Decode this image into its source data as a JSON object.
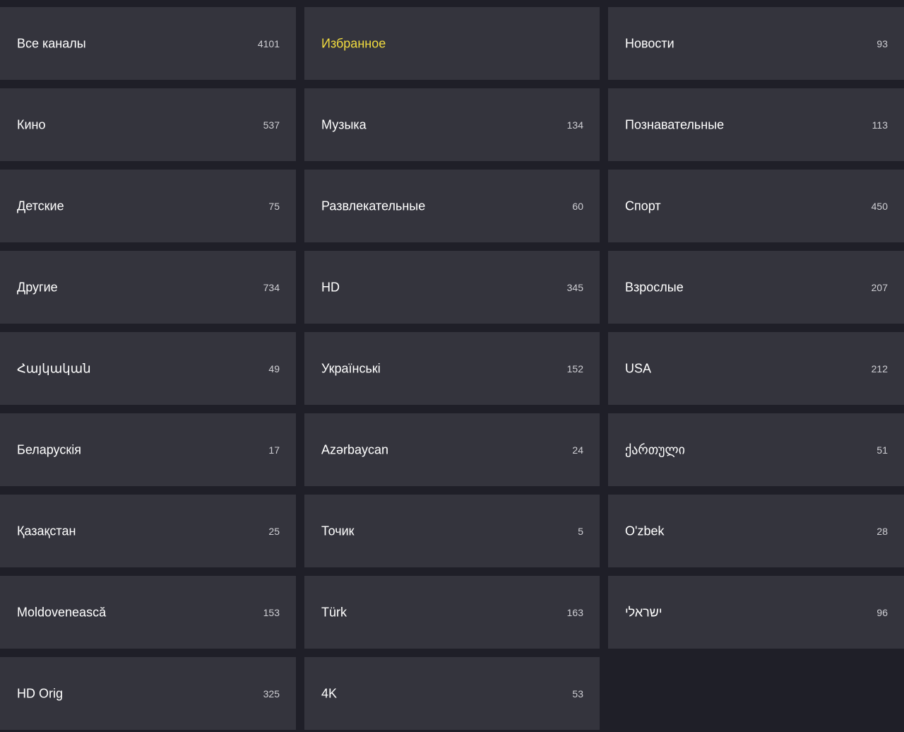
{
  "colors": {
    "background": "#1f1f28",
    "tile": "#34343d",
    "label": "#ffffff",
    "count": "#cfcfd4",
    "highlight": "#f2dc3f"
  },
  "categories": [
    {
      "label": "Все каналы",
      "count": "4101"
    },
    {
      "label": "Избранное",
      "count": "",
      "highlighted": true
    },
    {
      "label": "Новости",
      "count": "93"
    },
    {
      "label": "Кино",
      "count": "537"
    },
    {
      "label": "Музыка",
      "count": "134"
    },
    {
      "label": "Познавательные",
      "count": "113"
    },
    {
      "label": "Детские",
      "count": "75"
    },
    {
      "label": "Развлекательные",
      "count": "60"
    },
    {
      "label": "Спорт",
      "count": "450"
    },
    {
      "label": "Другие",
      "count": "734"
    },
    {
      "label": "HD",
      "count": "345"
    },
    {
      "label": "Взрослые",
      "count": "207"
    },
    {
      "label": "Հայկական",
      "count": "49"
    },
    {
      "label": "Українські",
      "count": "152"
    },
    {
      "label": "USA",
      "count": "212"
    },
    {
      "label": "Беларускія",
      "count": "17"
    },
    {
      "label": "Azərbaycan",
      "count": "24"
    },
    {
      "label": "ქართული",
      "count": "51"
    },
    {
      "label": "Қазақстан",
      "count": "25"
    },
    {
      "label": "Точик",
      "count": "5"
    },
    {
      "label": "O'zbek",
      "count": "28"
    },
    {
      "label": "Moldovenească",
      "count": "153"
    },
    {
      "label": "Türk",
      "count": "163"
    },
    {
      "label": "ישראלי",
      "count": "96"
    },
    {
      "label": "HD Orig",
      "count": "325"
    },
    {
      "label": "4K",
      "count": "53"
    }
  ]
}
